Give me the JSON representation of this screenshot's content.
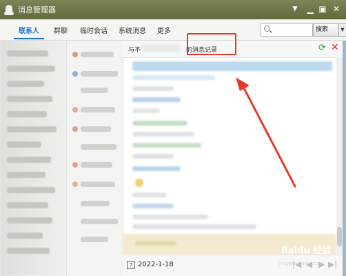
{
  "window": {
    "title": "消息管理器",
    "controls": {
      "menu": "▼",
      "minimize": "▁",
      "maximize": "▣",
      "close": "✕"
    }
  },
  "tabs": [
    {
      "label": "联系人",
      "active": true
    },
    {
      "label": "群聊",
      "active": false
    },
    {
      "label": "临时会话",
      "active": false
    },
    {
      "label": "系统消息",
      "active": false
    },
    {
      "label": "更多",
      "active": false
    }
  ],
  "search": {
    "placeholder": "",
    "button_label": "搜索",
    "dropdown_glyph": "▼"
  },
  "chat": {
    "header_prefix": "与不",
    "header_suffix": "的消息记录",
    "refresh_glyph": "⟳",
    "close_glyph": "✕",
    "date": "2022-1-18",
    "calendar_glyph": "7",
    "pager": [
      "|◀",
      "◀",
      "▶",
      "▶|"
    ]
  },
  "watermark": {
    "text": "Baidu 经验",
    "sub": "jingyan.baidu.com"
  },
  "colors": {
    "accent": "#1b6fbf",
    "annotation": "#e23a2a",
    "titlebar": "#6f7a4e",
    "refresh": "#2f9b30",
    "close": "#d22b2b"
  }
}
